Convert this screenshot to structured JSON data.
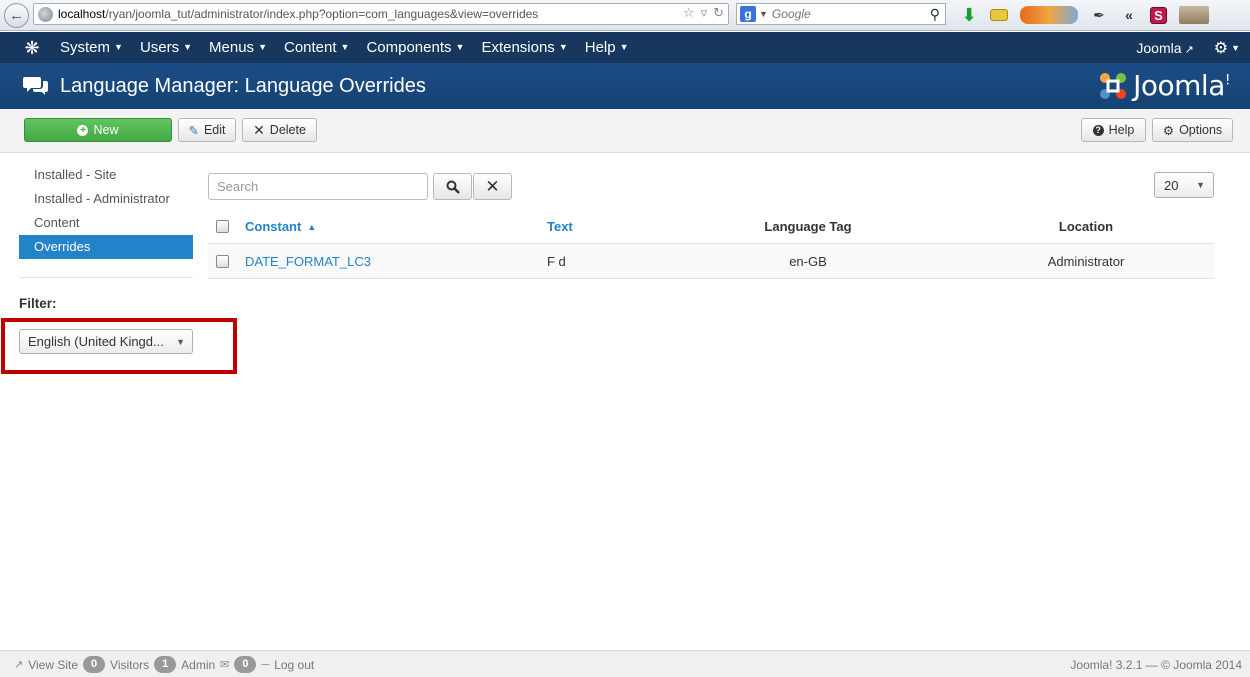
{
  "browser": {
    "url_host": "localhost",
    "url_path": "/ryan/joomla_tut/administrator/index.php?option=com_languages&view=overrides",
    "search_placeholder": "Google"
  },
  "topnav": {
    "items": [
      {
        "label": "System"
      },
      {
        "label": "Users"
      },
      {
        "label": "Menus"
      },
      {
        "label": "Content"
      },
      {
        "label": "Components"
      },
      {
        "label": "Extensions"
      },
      {
        "label": "Help"
      }
    ],
    "site_link": "Joomla"
  },
  "header": {
    "title": "Language Manager: Language Overrides",
    "brand": "Joomla",
    "brand_mark": "!"
  },
  "toolbar": {
    "new_label": "New",
    "edit_label": "Edit",
    "delete_label": "Delete",
    "help_label": "Help",
    "options_label": "Options"
  },
  "sidebar": {
    "items": [
      {
        "label": "Installed - Site",
        "active": false
      },
      {
        "label": "Installed - Administrator",
        "active": false
      },
      {
        "label": "Content",
        "active": false
      },
      {
        "label": "Overrides",
        "active": true
      }
    ],
    "filter_label": "Filter:",
    "filter_value": "English (United Kingd..."
  },
  "filters": {
    "search_placeholder": "Search",
    "limit": "20"
  },
  "table": {
    "headers": {
      "constant": "Constant",
      "text": "Text",
      "language_tag": "Language Tag",
      "location": "Location"
    },
    "rows": [
      {
        "constant": "DATE_FORMAT_LC3",
        "text": "F d",
        "language_tag": "en-GB",
        "location": "Administrator"
      }
    ]
  },
  "footer": {
    "view_site": "View Site",
    "visitors_count": "0",
    "visitors_label": "Visitors",
    "admin_count": "1",
    "admin_label": "Admin",
    "messages_count": "0",
    "logout": "Log out",
    "version": "Joomla! 3.2.1 — © Joomla 2014"
  },
  "colors": {
    "navbar": "#17375e",
    "header": "#1b4d86",
    "accent": "#2383c8",
    "new_button": "#46a546",
    "highlight": "#c00000"
  }
}
